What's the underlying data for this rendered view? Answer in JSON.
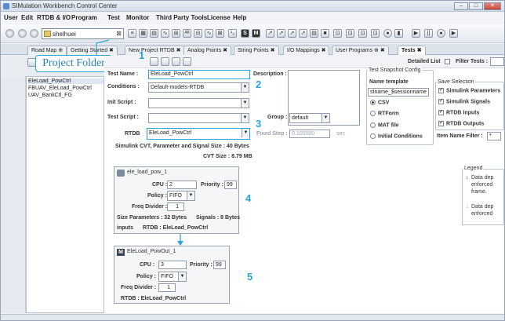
{
  "window": {
    "title": "SIMulation Workbench Control Center",
    "min": "–",
    "max": "□",
    "close": "✕"
  },
  "menu": [
    "User",
    "Edit",
    "RTDB & I/O",
    "Program",
    "Test",
    "Monitor",
    "Third Party Tools",
    "License",
    "Help"
  ],
  "toolbar": {
    "project_value": "shelhuei",
    "clear_glyph": "⊠",
    "glyphs": [
      "≡",
      "▦",
      "▤",
      "∿",
      "⊞",
      "ᴬᴮ",
      "⊟",
      "∿",
      "⊠",
      "¹₃",
      "S",
      "M",
      "↗",
      "↗",
      "↗",
      "↗",
      "▤",
      "■",
      "⊡",
      "⊡",
      "⊡",
      "⊡",
      "●",
      "▮",
      "▶",
      "||",
      "●",
      "▶"
    ]
  },
  "tabs": [
    {
      "label": "Road Map",
      "marker": "⊕"
    },
    {
      "label": "Getting Started",
      "marker": "✖"
    },
    {
      "label": "New Project RTDB",
      "marker": "✖"
    },
    {
      "label": "Analog Points",
      "marker": "✖"
    },
    {
      "label": "String Points",
      "marker": "✖"
    },
    {
      "label": "I/O Mappings",
      "marker": "✖"
    },
    {
      "label": "User Programs",
      "marker": "⊕ ✖"
    },
    {
      "label": "Tests",
      "marker": "✖"
    }
  ],
  "callout": {
    "label": "Project Folder"
  },
  "left_list": [
    "EleLoad_PowCtrl",
    "FBUAV_EleLoad_PowCtrl",
    "UAV_BankCtl_FG"
  ],
  "header_right": {
    "detailed_list": "Detailed List",
    "filter_tests": "Filter Tests :"
  },
  "form": {
    "test_name_label": "Test Name :",
    "test_name_value": "EleLoad_PowCtrl",
    "description_label": "Description :",
    "conditions_label": "Conditions :",
    "conditions_value": "Default-models-RTDB",
    "init_script_label": "Init Script :",
    "test_script_label": "Test Script :",
    "group_label": "Group :",
    "group_value": "default",
    "rtdb_label": "RTDB",
    "rtdb_value": "EleLoad_PowCtrl",
    "fixed_step_label": "Fixed Step :",
    "fixed_step_value": "0.100000",
    "fixed_step_unit": "sec",
    "cvt_line": "Simulink CVT, Parameter and Signal Size : 40 Bytes",
    "cvt_size_line": "CVT Size : 8.79 MB"
  },
  "snapshot": {
    "title": "Test Snapshot Config",
    "name_template_label": "Name template",
    "name_template_value": "stname_$sessionname",
    "formats": [
      {
        "label": "CSV",
        "selected": true
      },
      {
        "label": "RTForm",
        "selected": false
      },
      {
        "label": "MAT file",
        "selected": false
      },
      {
        "label": "Initial Conditions",
        "selected": false
      }
    ],
    "save_selection_title": "Save Selection",
    "save_items": [
      {
        "label": "Simulink Parameters",
        "checked": true
      },
      {
        "label": "Simulink Signals",
        "checked": true
      },
      {
        "label": "RTDB Inputs",
        "checked": true
      },
      {
        "label": "RTDB Outputs",
        "checked": true
      }
    ],
    "item_name_filter_label": "Item Name Filter :",
    "item_name_filter_value": "*"
  },
  "block1": {
    "title": "ele_load_pow_1",
    "cpu_label": "CPU :",
    "cpu_value": "2",
    "priority_label": "Priority :",
    "priority_value": "99",
    "policy_label": "Policy :",
    "policy_value": "FIFO",
    "freq_label": "Freq Divider :",
    "freq_value": "1",
    "size_params": "Size Parameters : 32 Bytes",
    "signals": "Signals : 8 Bytes",
    "inputs": "inputs",
    "rtdb_line": "RTDB : EleLoad_PowCtrl"
  },
  "block2": {
    "title": "EleLoad_PowOut_1",
    "cpu_label": "CPU :",
    "cpu_value": "3",
    "priority_label": "Priority :",
    "priority_value": "99",
    "policy_label": "Policy :",
    "policy_value": "FIFO",
    "freq_label": "Freq Divider :",
    "freq_value": "1",
    "rtdb_line": "RTDB : EleLoad_PowCtrl"
  },
  "legend": {
    "title": "Legend",
    "line1a": "Data dep",
    "line1b": "enforced",
    "line1c": "frame.",
    "line2a": "Data dep",
    "line2b": "enforced"
  },
  "annotations": [
    "1",
    "2",
    "3",
    "4",
    "5"
  ],
  "colors": {
    "annotation": "#2aa3d8"
  }
}
